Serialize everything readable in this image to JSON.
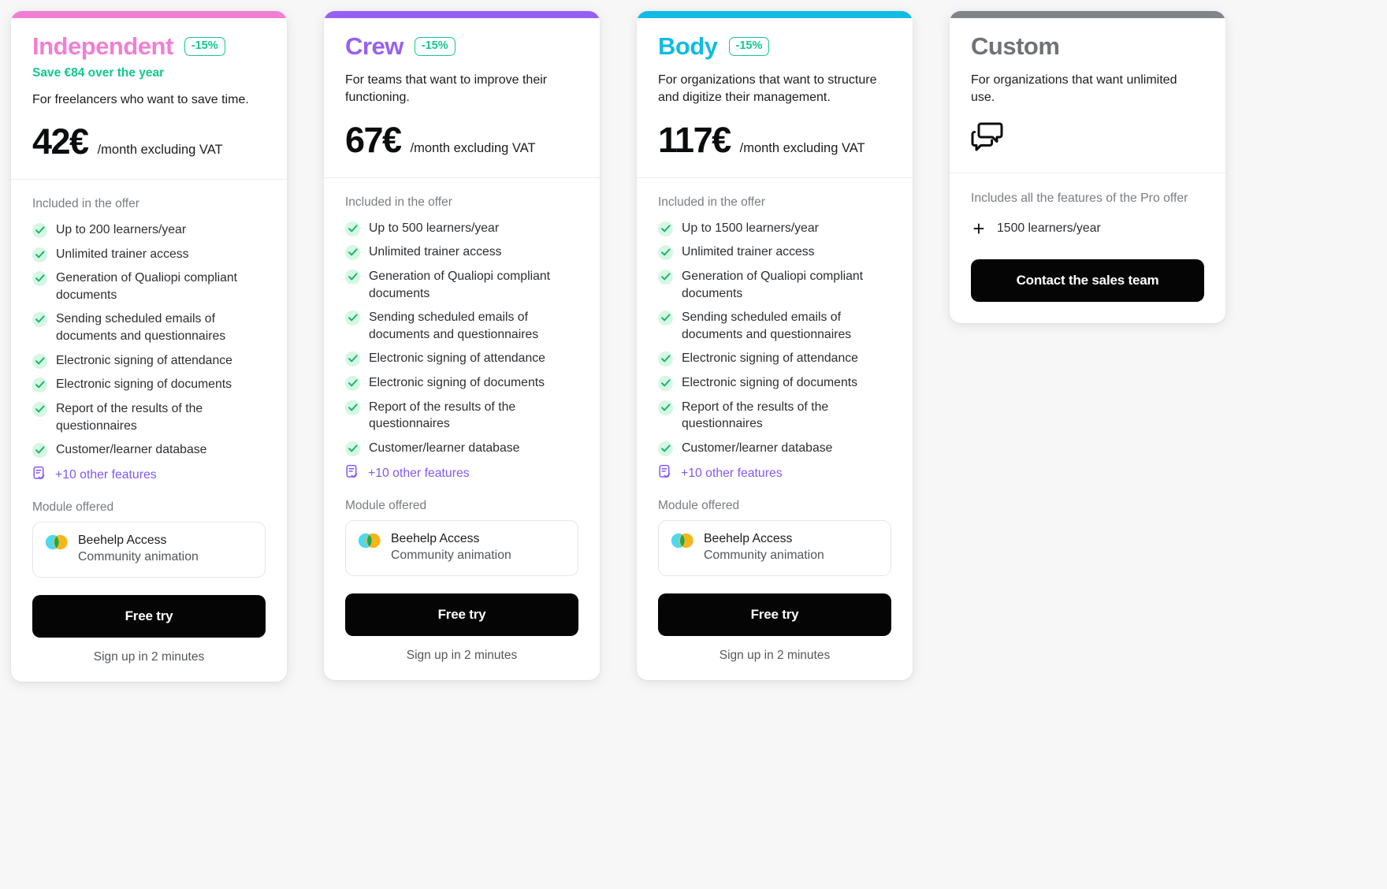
{
  "colors": {
    "independent_accent": "#f07fd4",
    "crew_accent": "#9760f5",
    "body_accent": "#11bbe3",
    "custom_accent": "#818589",
    "badge_green": "#10c98b",
    "check_green": "#17b26a",
    "check_bg": "#d5f7e3",
    "link_purple": "#8159f5",
    "button_black": "#050505",
    "bee_cyan": "#4fd8ee",
    "bee_amber": "#f5b61c",
    "bee_green": "#1aa85a"
  },
  "labels": {
    "included_in_the_offer": "Included in the offer",
    "module_offered": "Module offered",
    "signup_note": "Sign up in 2 minutes",
    "free_try": "Free try",
    "more_features": "+10 other features"
  },
  "plans": [
    {
      "id": "independent",
      "name": "Independent",
      "discount": "-15%",
      "save_line": "Save €84 over the year",
      "description": "For freelancers who want to save time.",
      "price": "42€",
      "price_suffix": "/month excluding VAT",
      "features": [
        "Up to 200 learners/year",
        "Unlimited trainer access",
        "Generation of Qualiopi compliant documents",
        "Sending scheduled emails of documents and questionnaires",
        "Electronic signing of attendance",
        "Electronic signing of documents",
        "Report of the results of the questionnaires",
        "Customer/learner database"
      ],
      "more_features": "+10 other features",
      "module_label": "Module offered",
      "module_name": "Beehelp Access",
      "module_sub": "Community animation",
      "cta": "Free try",
      "cta_note": "Sign up in 2 minutes"
    },
    {
      "id": "crew",
      "name": "Crew",
      "discount": "-15%",
      "save_line": "",
      "description": "For teams that want to improve their functioning.",
      "price": "67€",
      "price_suffix": "/month excluding VAT",
      "features": [
        "Up to 500 learners/year",
        "Unlimited trainer access",
        "Generation of Qualiopi compliant documents",
        "Sending scheduled emails of documents and questionnaires",
        "Electronic signing of attendance",
        "Electronic signing of documents",
        "Report of the results of the questionnaires",
        "Customer/learner database"
      ],
      "more_features": "+10 other features",
      "module_label": "Module offered",
      "module_name": "Beehelp Access",
      "module_sub": "Community animation",
      "cta": "Free try",
      "cta_note": "Sign up in 2 minutes"
    },
    {
      "id": "body",
      "name": "Body",
      "discount": "-15%",
      "save_line": "",
      "description": "For organizations that want to structure and digitize their management.",
      "price": "117€",
      "price_suffix": "/month excluding VAT",
      "features": [
        "Up to 1500 learners/year",
        "Unlimited trainer access",
        "Generation of Qualiopi compliant documents",
        "Sending scheduled emails of documents and questionnaires",
        "Electronic signing of attendance",
        "Electronic signing of documents",
        "Report of the results of the questionnaires",
        "Customer/learner database"
      ],
      "more_features": "+10 other features",
      "module_label": "Module offered",
      "module_name": "Beehelp Access",
      "module_sub": "Community animation",
      "cta": "Free try",
      "cta_note": "Sign up in 2 minutes"
    }
  ],
  "custom": {
    "id": "custom",
    "name": "Custom",
    "description": "For organizations that want unlimited use.",
    "includes_text": "Includes all the features of the Pro offer",
    "plus_item": "1500 learners/year",
    "cta": "Contact the sales team"
  }
}
